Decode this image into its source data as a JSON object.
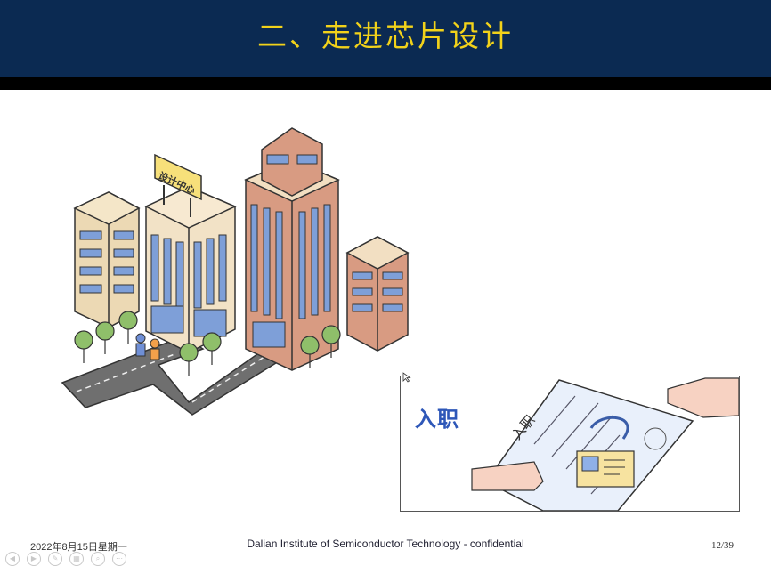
{
  "slide": {
    "title": "二、走进芯片设计",
    "sign_text": "设计中心",
    "join_label": "入职",
    "document_text": "入职"
  },
  "footer": {
    "date": "2022年8月15日星期一",
    "org": "Dalian Institute of Semiconductor Technology - confidential",
    "page": "12/39"
  },
  "toolbar": {
    "buttons": [
      {
        "icon": "arrow-left-icon",
        "glyph": "◀"
      },
      {
        "icon": "arrow-right-icon",
        "glyph": "▶"
      },
      {
        "icon": "pen-icon",
        "glyph": "✎"
      },
      {
        "icon": "slides-icon",
        "glyph": "▦"
      },
      {
        "icon": "zoom-icon",
        "glyph": "⌕"
      },
      {
        "icon": "more-icon",
        "glyph": "⋯"
      }
    ]
  },
  "colors": {
    "header_bg": "#0b2a52",
    "title": "#f2d21a",
    "join_label": "#2e57b8"
  }
}
